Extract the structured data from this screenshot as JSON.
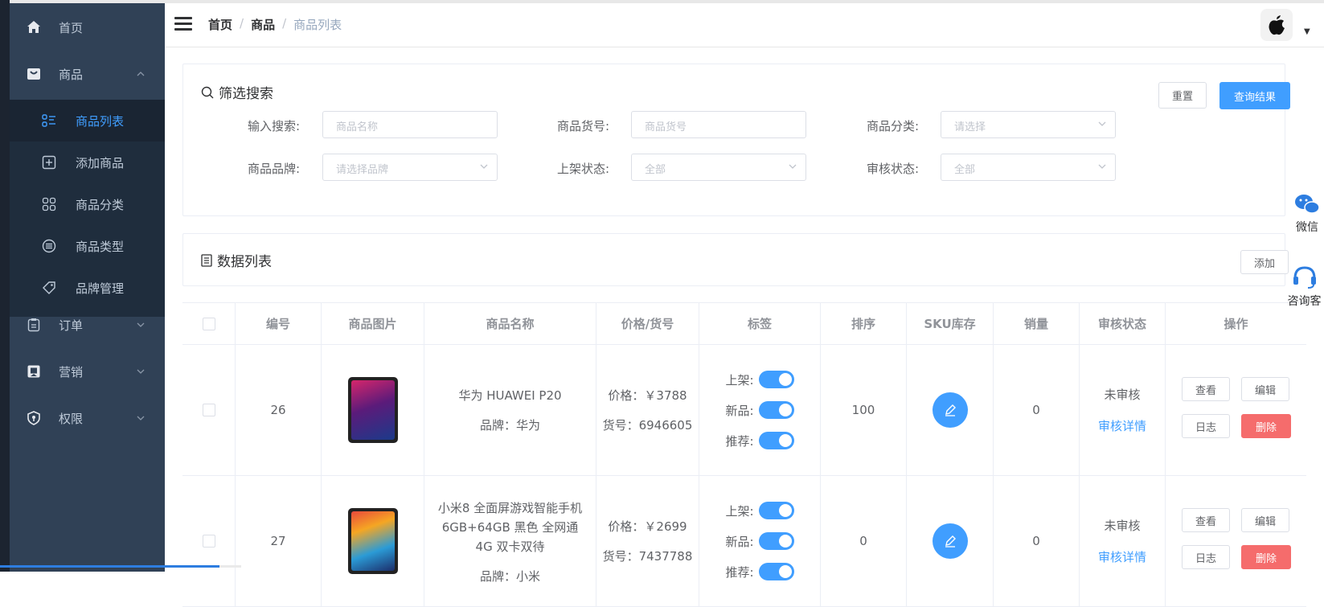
{
  "sidebar": {
    "home": "首页",
    "goods": "商品",
    "goods_sub": [
      {
        "label": "商品列表",
        "icon": "list-icon",
        "active": true
      },
      {
        "label": "添加商品",
        "icon": "plus-square-icon"
      },
      {
        "label": "商品分类",
        "icon": "grid-icon"
      },
      {
        "label": "商品类型",
        "icon": "list-circle-icon"
      },
      {
        "label": "品牌管理",
        "icon": "tag-icon"
      }
    ],
    "order": "订单",
    "marketing": "营销",
    "permission": "权限"
  },
  "header": {
    "breadcrumb": [
      "首页",
      "商品",
      "商品列表"
    ],
    "separator": "/"
  },
  "filter": {
    "title": "筛选搜索",
    "reset_label": "重置",
    "search_label": "查询结果",
    "fields": [
      {
        "label": "输入搜索:",
        "placeholder": "商品名称"
      },
      {
        "label": "商品货号:",
        "placeholder": "商品货号"
      },
      {
        "label": "商品分类:",
        "placeholder": "请选择"
      },
      {
        "label": "商品品牌:",
        "placeholder": "请选择品牌"
      },
      {
        "label": "上架状态:",
        "placeholder": "全部"
      },
      {
        "label": "审核状态:",
        "placeholder": "全部"
      }
    ]
  },
  "datalist": {
    "title": "数据列表",
    "add_label": "添加"
  },
  "table": {
    "columns": [
      "编号",
      "商品图片",
      "商品名称",
      "价格/货号",
      "标签",
      "排序",
      "SKU库存",
      "销量",
      "审核状态",
      "操作"
    ],
    "tag_labels": [
      "上架:",
      "新品:",
      "推荐:"
    ],
    "rows": [
      {
        "id": "26",
        "name": "华为 HUAWEI P20",
        "brand": "品牌：华为",
        "price": "价格：￥3788",
        "sn": "货号：6946605",
        "sort": "100",
        "sales": "0",
        "status": "未审核",
        "detail": "审核详情"
      },
      {
        "id": "27",
        "name": "小米8 全面屏游戏智能手机 6GB+64GB 黑色 全网通4G 双卡双待",
        "brand": "品牌：小米",
        "price": "价格：￥2699",
        "sn": "货号：7437788",
        "sort": "0",
        "sales": "0",
        "status": "未审核",
        "detail": "审核详情"
      }
    ],
    "actions": {
      "view": "查看",
      "edit": "编辑",
      "log": "日志",
      "delete": "删除"
    }
  },
  "float": {
    "wechat": "微信",
    "consult": "咨询客"
  },
  "progress": 0.166,
  "colors": {
    "sidebar": "#304156",
    "submenu": "#1f2d3d",
    "accent": "#409eff",
    "danger": "#f56c6c"
  }
}
